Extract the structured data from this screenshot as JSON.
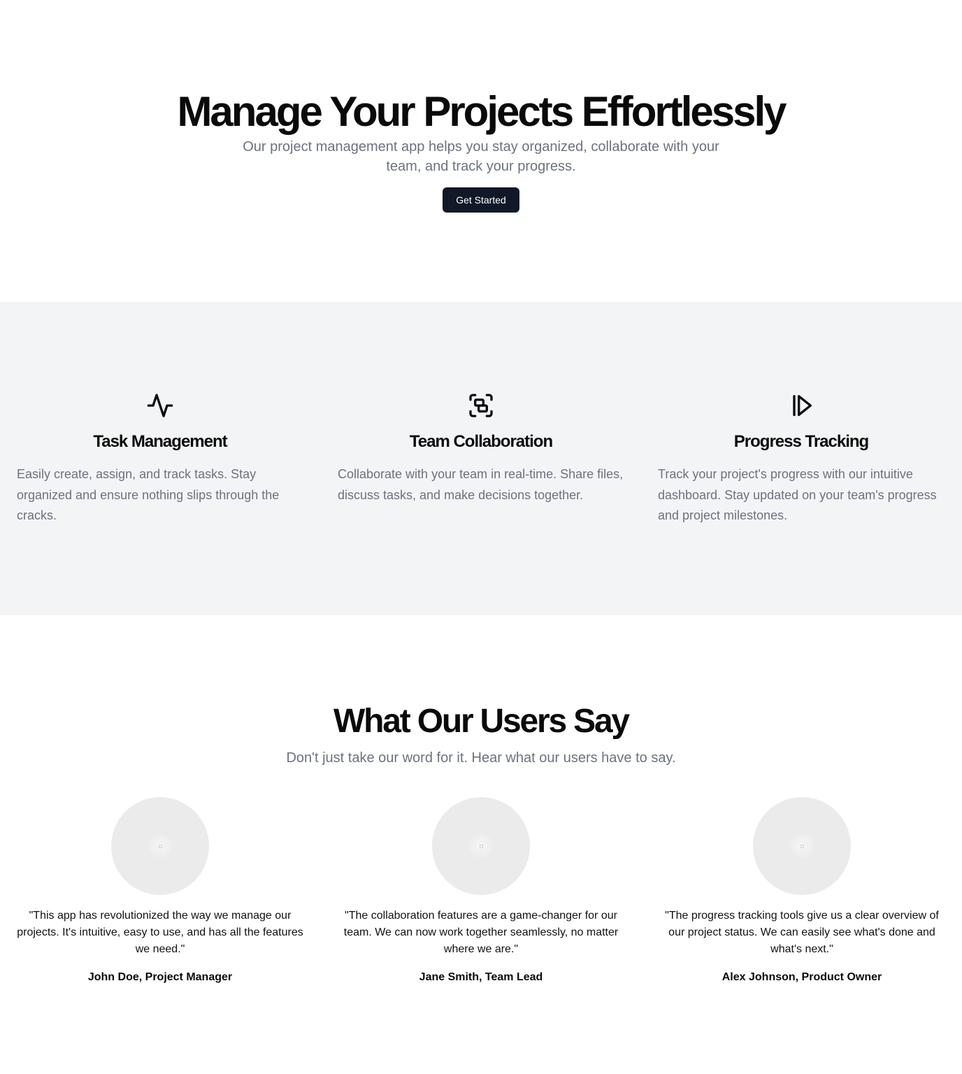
{
  "hero": {
    "title": "Manage Your Projects Effortlessly",
    "subtitle": "Our project management app helps you stay organized, collaborate with your team, and track your progress.",
    "cta_label": "Get Started"
  },
  "features": [
    {
      "icon": "activity-icon",
      "title": "Task Management",
      "description": "Easily create, assign, and track tasks. Stay organized and ensure nothing slips through the cracks."
    },
    {
      "icon": "group-icon",
      "title": "Team Collaboration",
      "description": "Collaborate with your team in real-time. Share files, discuss tasks, and make decisions together."
    },
    {
      "icon": "step-forward-icon",
      "title": "Progress Tracking",
      "description": "Track your project's progress with our intuitive dashboard. Stay updated on your team's progress and project milestones."
    }
  ],
  "testimonials": {
    "title": "What Our Users Say",
    "subtitle": "Don't just take our word for it. Hear what our users have to say.",
    "items": [
      {
        "quote": "\"This app has revolutionized the way we manage our projects. It's intuitive, easy to use, and has all the features we need.\"",
        "author": "John Doe, Project Manager"
      },
      {
        "quote": "\"The collaboration features are a game-changer for our team. We can now work together seamlessly, no matter where we are.\"",
        "author": "Jane Smith, Team Lead"
      },
      {
        "quote": "\"The progress tracking tools give us a clear overview of our project status. We can easily see what's done and what's next.\"",
        "author": "Alex Johnson, Product Owner"
      }
    ]
  },
  "colors": {
    "text": "#0a0a0a",
    "muted": "#6b7280",
    "button": "#111827",
    "section_bg": "#f3f4f6",
    "avatar_placeholder": "#ebebeb"
  }
}
